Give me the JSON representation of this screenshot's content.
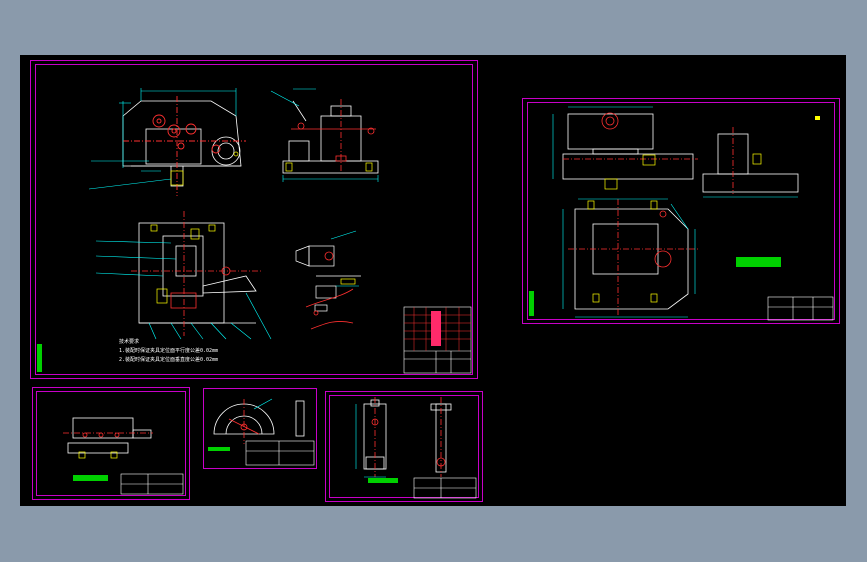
{
  "app": {
    "canvas_background": "#000000",
    "workspace_background": "#8a9aab",
    "frame_color": "#c800c8"
  },
  "sheets": {
    "assembly": {
      "notes_title": "技术要求",
      "notes_line1": "1.装配时保证夹具定位面平行度公差0.02mm",
      "notes_line2": "2.装配时保证夹具定位面垂直度公差0.02mm"
    }
  }
}
